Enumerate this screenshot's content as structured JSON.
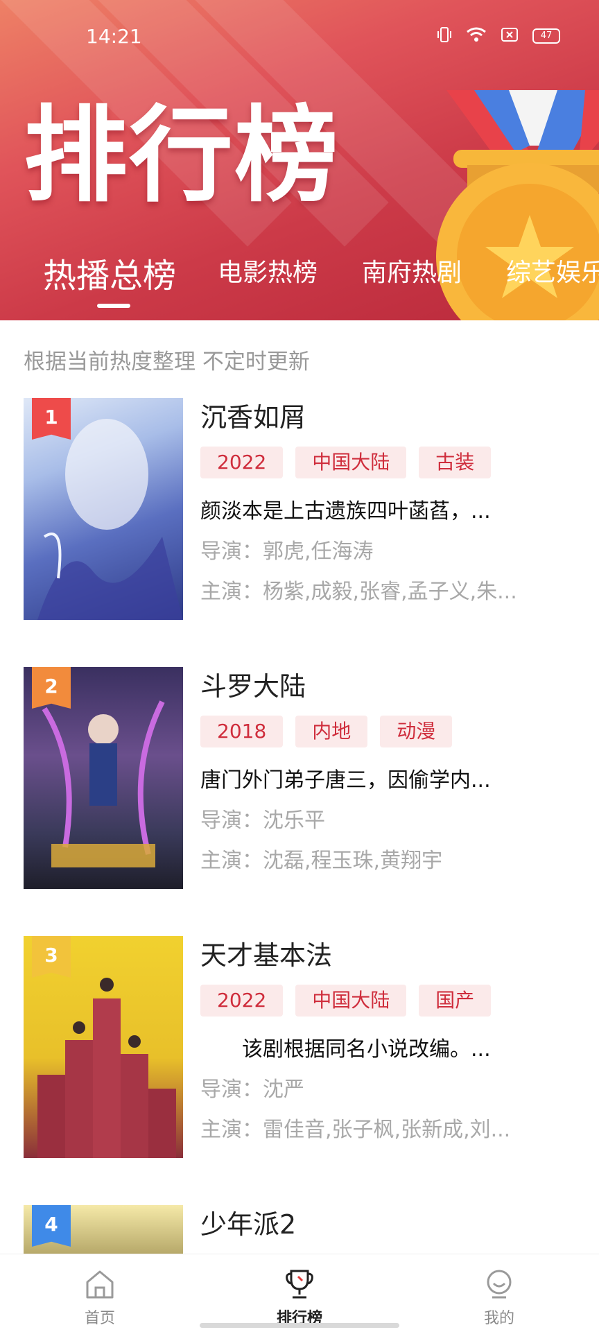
{
  "status_bar": {
    "time": "14:21",
    "battery": "47"
  },
  "header": {
    "title": "排行榜",
    "tabs": [
      {
        "label": "热播总榜",
        "active": true
      },
      {
        "label": "电影热榜",
        "active": false
      },
      {
        "label": "南府热剧",
        "active": false
      },
      {
        "label": "综艺娱乐",
        "active": false
      }
    ]
  },
  "subtitle": "根据当前热度整理 不定时更新",
  "rank_colors": [
    "#ee4b4a",
    "#f28b3c",
    "#f2c33b",
    "#3f8ae8"
  ],
  "items": [
    {
      "rank": "1",
      "name": "沉香如屑",
      "tags": [
        "2022",
        "中国大陆",
        "古装"
      ],
      "desc": "颜淡本是上古遗族四叶菡萏，...",
      "director": "导演：郭虎,任海涛",
      "cast": "主演：杨紫,成毅,张睿,孟子义,朱..."
    },
    {
      "rank": "2",
      "name": "斗罗大陆",
      "tags": [
        "2018",
        "内地",
        "动漫"
      ],
      "desc": "唐门外门弟子唐三，因偷学内...",
      "director": "导演：沈乐平",
      "cast": "主演：沈磊,程玉珠,黄翔宇"
    },
    {
      "rank": "3",
      "name": "天才基本法",
      "tags": [
        "2022",
        "中国大陆",
        "国产"
      ],
      "desc": "　　该剧根据同名小说改编。...",
      "director": "导演：沈严",
      "cast": "主演：雷佳音,张子枫,张新成,刘..."
    },
    {
      "rank": "4",
      "name": "少年派2"
    }
  ],
  "bottom_nav": [
    {
      "label": "首页",
      "icon": "home-icon",
      "active": false
    },
    {
      "label": "排行榜",
      "icon": "trophy-icon",
      "active": true
    },
    {
      "label": "我的",
      "icon": "profile-icon",
      "active": false
    }
  ]
}
